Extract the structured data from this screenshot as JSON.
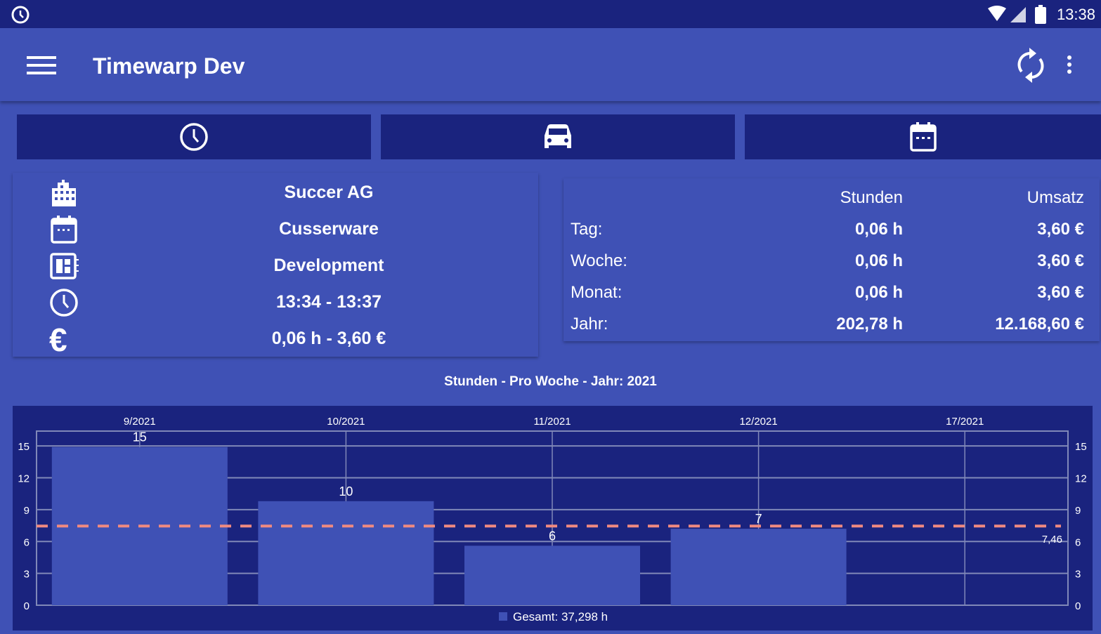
{
  "status_bar": {
    "time": "13:38",
    "icons": [
      "alarm-clock-icon",
      "wifi-icon",
      "signal-icon",
      "battery-icon"
    ]
  },
  "app_bar": {
    "title": "Timewarp Dev",
    "icons": [
      "menu-icon",
      "sync-icon",
      "more-vert-icon"
    ]
  },
  "mode_tabs": [
    {
      "icon": "clock-icon"
    },
    {
      "icon": "car-icon"
    },
    {
      "icon": "calendar-icon"
    }
  ],
  "current_entry": {
    "client": "Succer AG",
    "project": "Cusserware",
    "task": "Development",
    "time_range": "13:34 - 13:37",
    "amount": "0,06 h - 3,60 €",
    "icons": [
      "building-icon",
      "calendar-icon",
      "task-icon",
      "clock-icon",
      "euro-icon"
    ]
  },
  "summary": {
    "headers": {
      "hours": "Stunden",
      "revenue": "Umsatz"
    },
    "rows": [
      {
        "label": "Tag:",
        "hours": "0,06 h",
        "revenue": "3,60 €"
      },
      {
        "label": "Woche:",
        "hours": "0,06 h",
        "revenue": "3,60 €"
      },
      {
        "label": "Monat:",
        "hours": "0,06 h",
        "revenue": "3,60 €"
      },
      {
        "label": "Jahr:",
        "hours": "202,78 h",
        "revenue": "12.168,60 €"
      }
    ]
  },
  "colors": {
    "primary": "#3f51b5",
    "primary_dark": "#1a237e",
    "average_line": "#ef8a80",
    "grid": "#8088b8"
  },
  "chart_data": {
    "type": "bar",
    "title": "Stunden - Pro Woche - Jahr: 2021",
    "categories": [
      "9/2021",
      "10/2021",
      "11/2021",
      "12/2021",
      "17/2021"
    ],
    "values": [
      14.9,
      9.8,
      5.6,
      7.2,
      null
    ],
    "data_labels": [
      "15",
      "10",
      "6",
      "7",
      ""
    ],
    "yticks": [
      0,
      3,
      6,
      9,
      12,
      15
    ],
    "ylim": [
      0,
      16.4
    ],
    "average": {
      "value": 7.46,
      "label": "7,46"
    },
    "legend": {
      "label": "Gesamt: 37,298 h",
      "placement": "bottom-center"
    },
    "grid": true
  }
}
